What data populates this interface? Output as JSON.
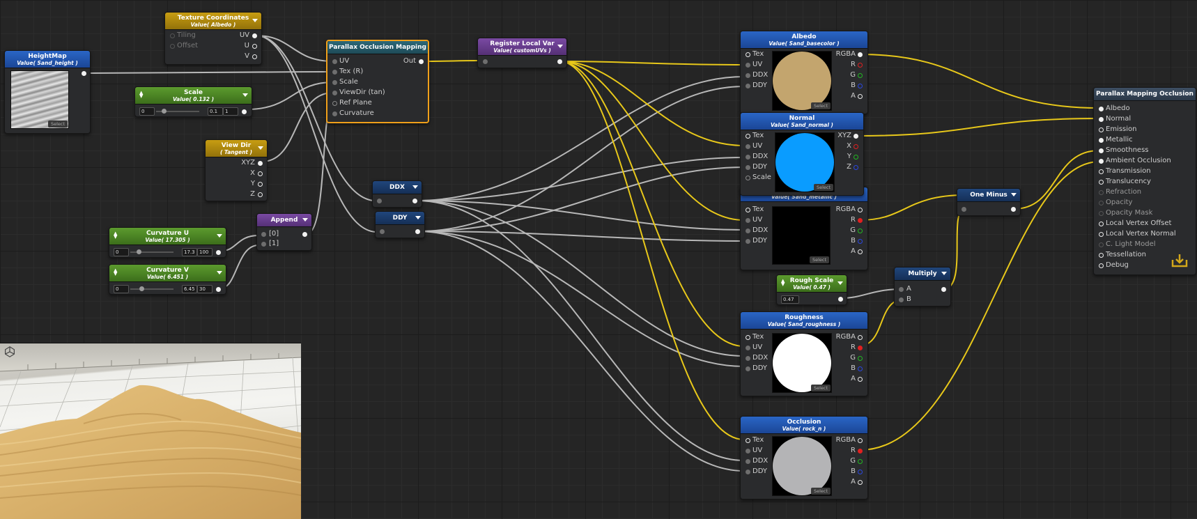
{
  "nodes": {
    "heightmap": {
      "title": "HeightMap",
      "subtitle": "Value( Sand_height )",
      "select": "Select"
    },
    "texcoord": {
      "title": "Texture Coordinates",
      "subtitle": "Value( Albedo )",
      "inputs": [
        "Tiling",
        "Offset"
      ],
      "outputs": [
        "UV",
        "U",
        "V"
      ]
    },
    "scale": {
      "title": "Scale",
      "subtitle": "Value( 0.132 )",
      "min": "0",
      "value": "0.1",
      "max": "1"
    },
    "viewdir": {
      "title": "View Dir",
      "subtitle": "( Tangent )",
      "outputs": [
        "XYZ",
        "X",
        "Y",
        "Z"
      ]
    },
    "pom": {
      "title": "Parallax Occlusion Mapping",
      "inputs": [
        "UV",
        "Tex (R)",
        "Scale",
        "ViewDir (tan)",
        "Ref Plane",
        "Curvature"
      ],
      "output": "Out"
    },
    "reglocal": {
      "title": "Register Local Var",
      "subtitle": "Value( customUVs )"
    },
    "curvu": {
      "title": "Curvature U",
      "subtitle": "Value( 17.305 )",
      "min": "0",
      "value": "17.3",
      "max": "100"
    },
    "curvv": {
      "title": "Curvature V",
      "subtitle": "Value( 6.451 )",
      "min": "0",
      "value": "6.45",
      "max": "30"
    },
    "append": {
      "title": "Append",
      "inputs": [
        "[0]",
        "[1]"
      ]
    },
    "ddx": {
      "title": "DDX"
    },
    "ddy": {
      "title": "DDY"
    },
    "albedo": {
      "title": "Albedo",
      "subtitle": "Value( Sand_basecolor )",
      "inputs": [
        "Tex",
        "UV",
        "DDX",
        "DDY"
      ],
      "outputs": [
        "RGBA",
        "R",
        "G",
        "B",
        "A"
      ],
      "select": "Select"
    },
    "normal": {
      "title": "Normal",
      "subtitle": "Value( Sand_normal )",
      "inputs": [
        "Tex",
        "UV",
        "DDX",
        "DDY",
        "Scale"
      ],
      "outputs": [
        "XYZ",
        "X",
        "Y",
        "Z"
      ],
      "select": "Select"
    },
    "metallic": {
      "subtitle": "Value( Sand_metallic )",
      "inputs": [
        "Tex",
        "UV",
        "DDX",
        "DDY"
      ],
      "outputs": [
        "RGBA",
        "R",
        "G",
        "B",
        "A"
      ],
      "select": "Select"
    },
    "roughscale": {
      "title": "Rough Scale",
      "subtitle": "Value( 0.47 )",
      "value": "0.47"
    },
    "multiply": {
      "title": "Multiply",
      "inputs": [
        "A",
        "B"
      ]
    },
    "oneminus": {
      "title": "One Minus"
    },
    "roughness": {
      "title": "Roughness",
      "subtitle": "Value( Sand_roughness )",
      "inputs": [
        "Tex",
        "UV",
        "DDX",
        "DDY"
      ],
      "outputs": [
        "RGBA",
        "R",
        "G",
        "B",
        "A"
      ],
      "select": "Select"
    },
    "occlusion": {
      "title": "Occlusion",
      "subtitle": "Value( rock_n )",
      "inputs": [
        "Tex",
        "UV",
        "DDX",
        "DDY"
      ],
      "outputs": [
        "RGBA",
        "R",
        "G",
        "B",
        "A"
      ],
      "select": "Select"
    },
    "master": {
      "title": "Parallax Mapping Occlusion",
      "inputs": [
        "Albedo",
        "Normal",
        "Emission",
        "Metallic",
        "Smoothness",
        "Ambient Occlusion",
        "Transmission",
        "Translucency",
        "Refraction",
        "Opacity",
        "Opacity Mask",
        "Local Vertex Offset",
        "Local Vertex Normal",
        "C. Light Model",
        "Tessellation",
        "Debug"
      ]
    }
  },
  "colors": {
    "wire_white": "#c8c8c8",
    "wire_yellow": "#e8c81a",
    "selected_outline": "#f0a01a",
    "albedo_preview": "#c3a56e",
    "normal_preview": "#0a9cff",
    "roughness_preview": "#ffffff",
    "occlusion_preview": "#b4b4b6"
  },
  "icons": [
    "dropdown-arrow-icon",
    "stepper-icon",
    "unity-logo-icon",
    "save-icon"
  ]
}
